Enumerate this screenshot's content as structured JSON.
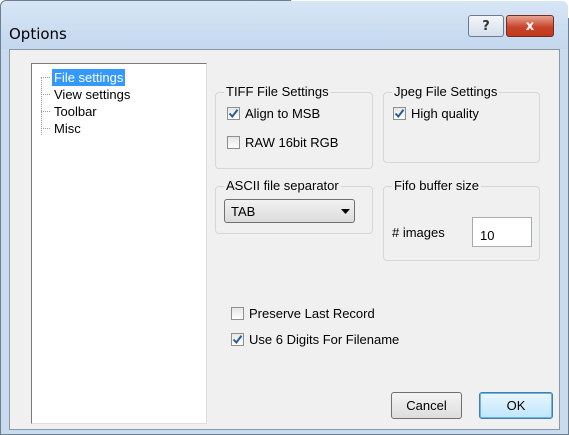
{
  "window": {
    "title": "Options"
  },
  "caption_buttons": {
    "help": "?",
    "close": "x"
  },
  "tree": {
    "items": [
      {
        "label": "File settings",
        "selected": true
      },
      {
        "label": "View settings",
        "selected": false
      },
      {
        "label": "Toolbar",
        "selected": false
      },
      {
        "label": "Misc",
        "selected": false
      }
    ]
  },
  "tiff": {
    "title": "TIFF File Settings",
    "align_msb": {
      "label": "Align to MSB",
      "checked": true
    },
    "raw_16bit": {
      "label": "RAW 16bit RGB",
      "checked": false
    }
  },
  "jpeg": {
    "title": "Jpeg File Settings",
    "high_quality": {
      "label": "High quality",
      "checked": true
    }
  },
  "ascii": {
    "title": "ASCII file separator",
    "selected": "TAB"
  },
  "fifo": {
    "title": "Fifo buffer size",
    "images_label": "# images",
    "images_value": "10"
  },
  "options": {
    "preserve_last_record": {
      "label": "Preserve Last Record",
      "checked": false
    },
    "six_digits": {
      "label": "Use 6 Digits For Filename",
      "checked": true
    }
  },
  "buttons": {
    "cancel": "Cancel",
    "ok": "OK"
  }
}
